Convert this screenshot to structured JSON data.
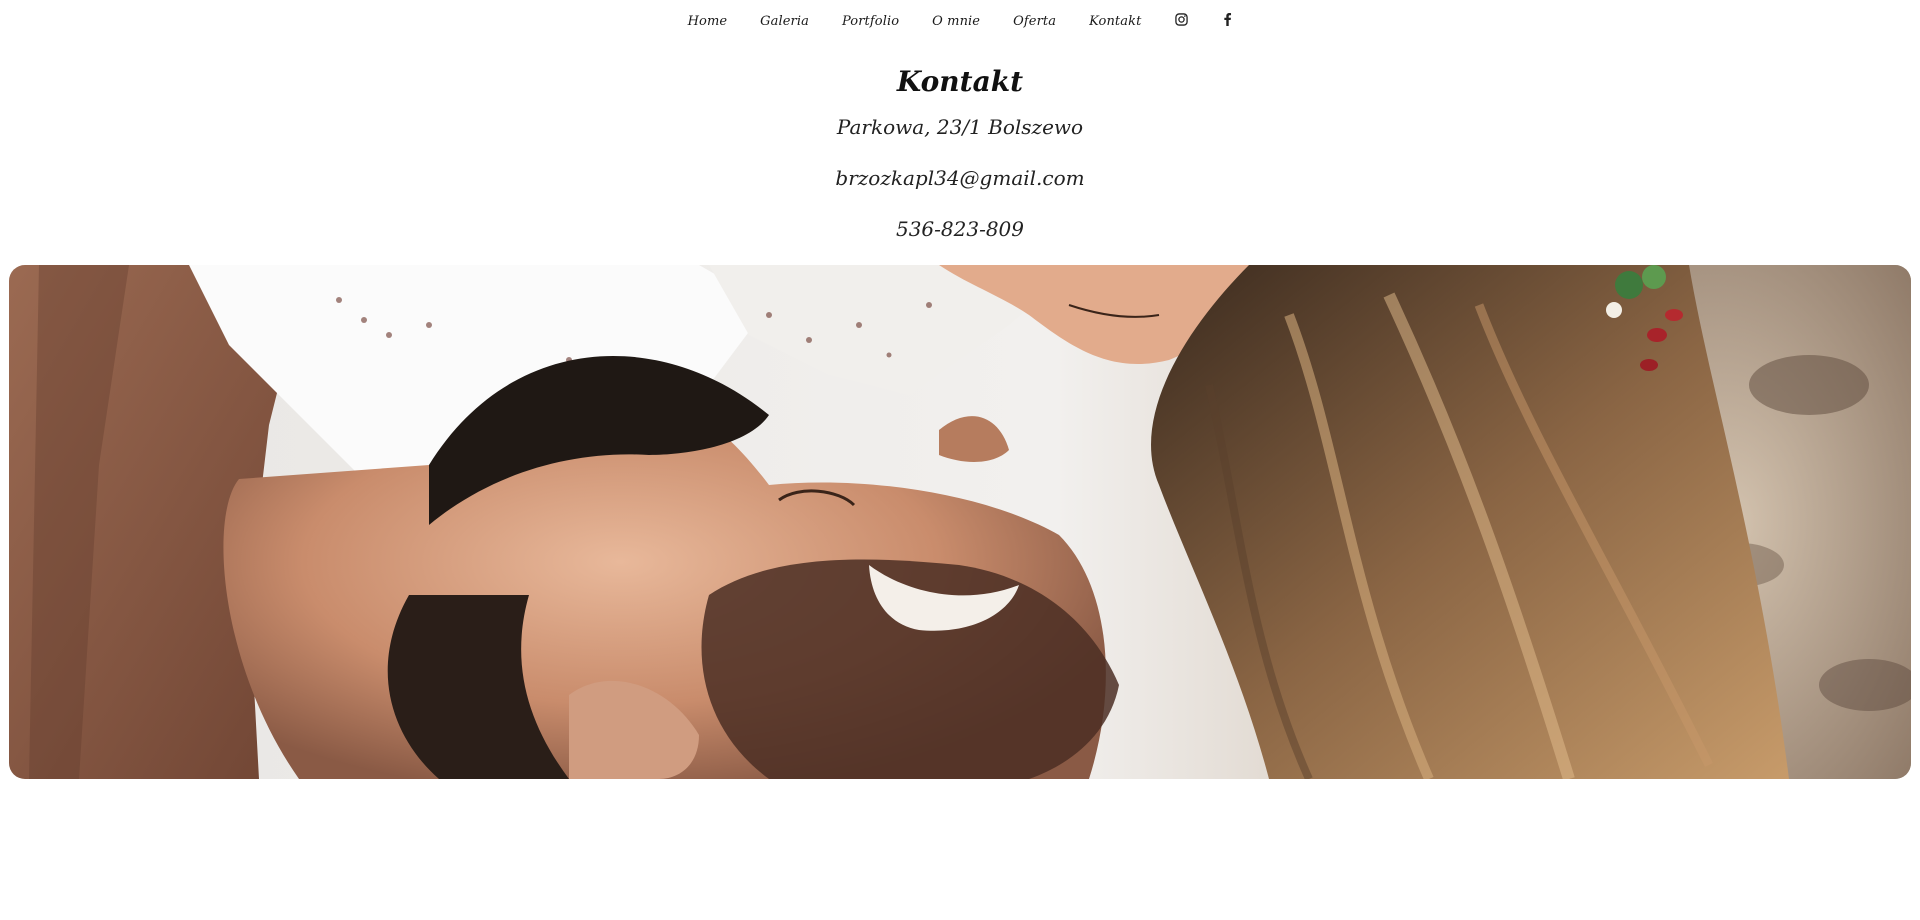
{
  "nav": {
    "items": [
      {
        "label": "Home"
      },
      {
        "label": "Galeria"
      },
      {
        "label": "Portfolio"
      },
      {
        "label": "O mnie"
      },
      {
        "label": "Oferta"
      },
      {
        "label": "Kontakt"
      }
    ],
    "icons": [
      "instagram-icon",
      "facebook-icon"
    ]
  },
  "contact": {
    "title": "Kontakt",
    "address": "Parkowa, 23/1 Bolszewo",
    "email": "brzozkapl34@gmail.com",
    "phone": "536-823-809"
  },
  "hero": {
    "image": "wedding-couple-photo"
  },
  "colors": {
    "background": "#ffffff",
    "text": "#111111"
  }
}
